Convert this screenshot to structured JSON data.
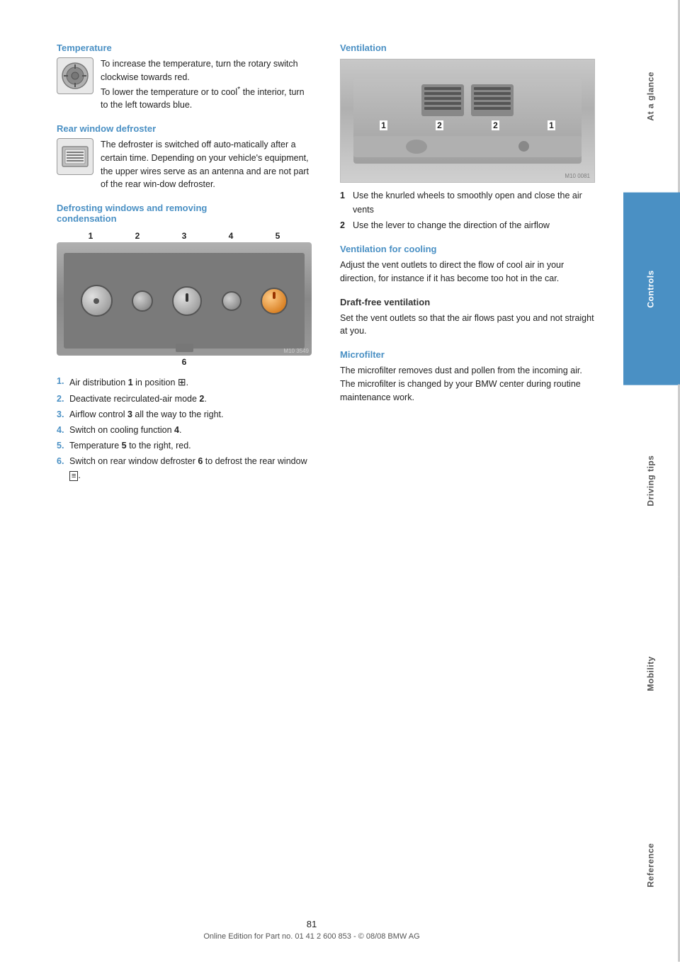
{
  "page": {
    "number": "81",
    "footer_text": "Online Edition for Part no. 01 41 2 600 853 - © 08/08 BMW AG"
  },
  "sidebar": {
    "tabs": [
      {
        "id": "at-a-glance",
        "label": "At a glance",
        "active": false
      },
      {
        "id": "controls",
        "label": "Controls",
        "active": true
      },
      {
        "id": "driving-tips",
        "label": "Driving tips",
        "active": false
      },
      {
        "id": "mobility",
        "label": "Mobility",
        "active": false
      },
      {
        "id": "reference",
        "label": "Reference",
        "active": false
      }
    ]
  },
  "left_column": {
    "temperature": {
      "title": "Temperature",
      "text": "To increase the temperature, turn the rotary switch clockwise towards red.\nTo lower the temperature or to cool* the interior, turn to the left towards blue."
    },
    "rear_window": {
      "title": "Rear window defroster",
      "text": "The defroster is switched off auto-matically after a certain time. Depending on your vehicle's equipment, the upper wires serve as an antenna and are not part of the rear window defroster."
    },
    "defrosting": {
      "title": "Defrosting windows and removing condensation",
      "diagram_numbers": [
        "1",
        "2",
        "3",
        "4",
        "5"
      ],
      "diagram_number_6": "6",
      "steps": [
        {
          "num": "1.",
          "text": "Air distribution ",
          "bold": "1",
          "text2": " in position ",
          "icon": "⊞",
          "text3": "."
        },
        {
          "num": "2.",
          "text": "Deactivate recirculated-air mode ",
          "bold": "2",
          "text3": "."
        },
        {
          "num": "3.",
          "text": "Airflow control ",
          "bold": "3",
          "text2": " all the way to the right."
        },
        {
          "num": "4.",
          "text": "Switch on cooling function ",
          "bold": "4",
          "text3": "."
        },
        {
          "num": "5.",
          "text": "Temperature ",
          "bold": "5",
          "text2": " to the right, red."
        },
        {
          "num": "6.",
          "text": "Switch on rear window defroster ",
          "bold": "6",
          "text2": " to defrost the rear window ",
          "icon": "⊟",
          "text3": "."
        }
      ]
    }
  },
  "right_column": {
    "ventilation": {
      "title": "Ventilation",
      "diagram_numbers": [
        "1",
        "2",
        "2",
        "1"
      ],
      "items": [
        {
          "num": "1",
          "text": "Use the knurled wheels to smoothly open and close the air vents"
        },
        {
          "num": "2",
          "text": "Use the lever to change the direction of the airflow"
        }
      ]
    },
    "ventilation_for_cooling": {
      "title": "Ventilation for cooling",
      "text": "Adjust the vent outlets to direct the flow of cool air in your direction, for instance if it has become too hot in the car."
    },
    "draft_free": {
      "title": "Draft-free ventilation",
      "text": "Set the vent outlets so that the air flows past you and not straight at you."
    },
    "microfilter": {
      "title": "Microfilter",
      "text": "The microfilter removes dust and pollen from the incoming air. The microfilter is changed by your BMW center during routine maintenance work."
    }
  }
}
